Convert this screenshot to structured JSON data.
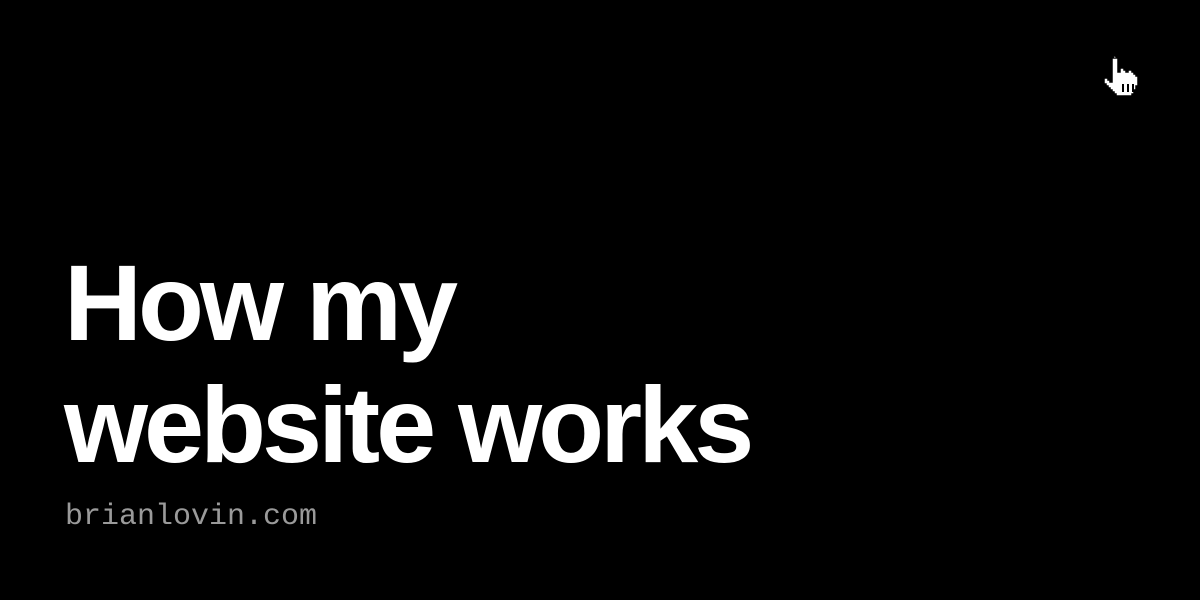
{
  "card": {
    "title_lines": [
      "How my",
      "website works"
    ],
    "site": "brianlovin.com",
    "logo_icon": "pointing-hand-cursor-icon"
  },
  "colors": {
    "background": "#000000",
    "title": "#ffffff",
    "site": "#9a9a9a"
  }
}
